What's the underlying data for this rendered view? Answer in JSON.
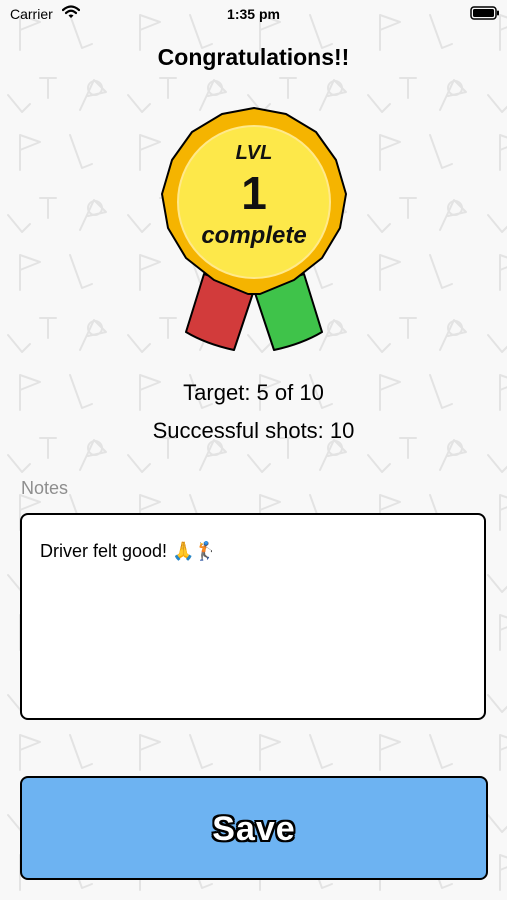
{
  "status_bar": {
    "carrier": "Carrier",
    "time": "1:35 pm",
    "wifi_icon": "wifi-icon",
    "battery_icon": "battery-icon"
  },
  "header": {
    "title": "Congratulations!!"
  },
  "medal": {
    "lvl_label": "LVL",
    "level_number": "1",
    "status_label": "complete",
    "colors": {
      "rim": "#f5b400",
      "face": "#fde84a",
      "ribbon_left": "#d23b3b",
      "ribbon_right": "#3fc34a"
    }
  },
  "stats": {
    "target": "Target: 5 of 10",
    "successful": "Successful shots: 10"
  },
  "notes": {
    "label": "Notes",
    "value": "Driver felt good! 🙏🏌️"
  },
  "actions": {
    "save_label": "Save",
    "save_color": "#6db3f2"
  }
}
